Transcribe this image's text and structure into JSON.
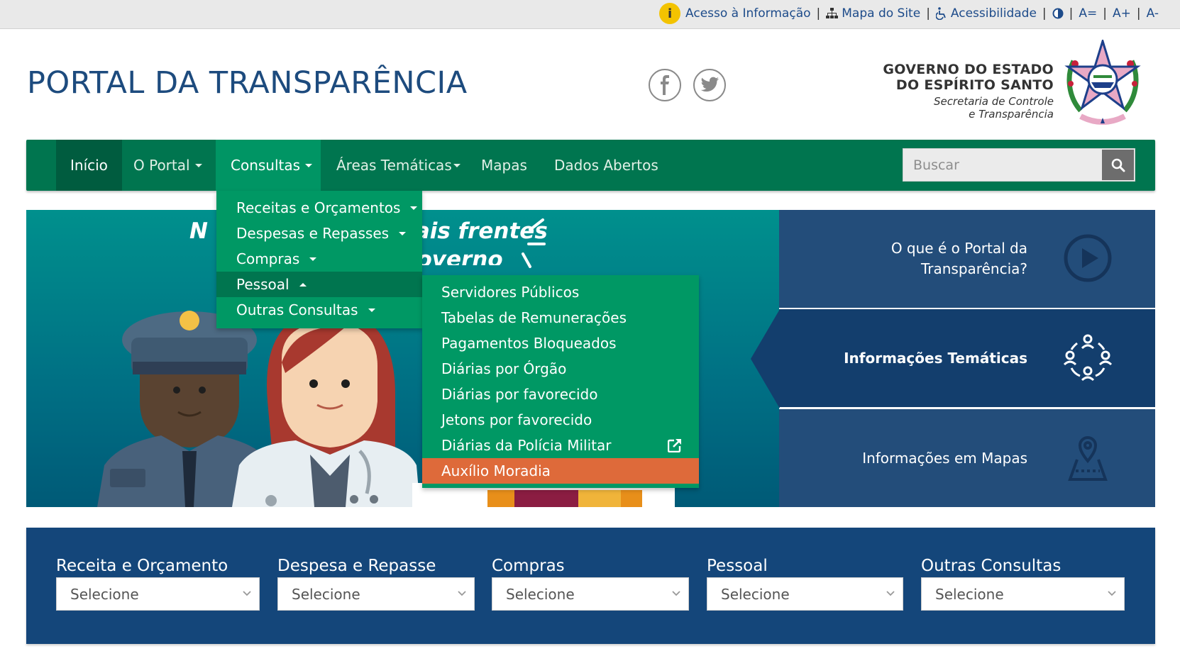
{
  "topbar": {
    "access_info": "Acesso à Informação",
    "site_map": "Mapa do Site",
    "accessibility": "Acessibilidade",
    "font_reset": "A=",
    "font_increase": "A+",
    "font_decrease": "A-",
    "separator": "|"
  },
  "header": {
    "title": "PORTAL DA TRANSPARÊNCIA",
    "gov_line1": "GOVERNO DO ESTADO",
    "gov_line2": "DO ESPÍRITO SANTO",
    "gov_line3": "Secretaria de Controle",
    "gov_line4": "e Transparência"
  },
  "nav": {
    "items": [
      {
        "label": "Início"
      },
      {
        "label": "O Portal"
      },
      {
        "label": "Consultas"
      },
      {
        "label": "Áreas Temáticas"
      },
      {
        "label": "Mapas"
      },
      {
        "label": "Dados Abertos"
      }
    ],
    "search_placeholder": "Buscar"
  },
  "consultas_menu": {
    "items": [
      {
        "label": "Receitas e Orçamentos"
      },
      {
        "label": "Despesas e Repasses"
      },
      {
        "label": "Compras"
      },
      {
        "label": "Pessoal"
      },
      {
        "label": "Outras Consultas"
      }
    ]
  },
  "pessoal_menu": {
    "items": [
      {
        "label": "Servidores Públicos"
      },
      {
        "label": "Tabelas de Remunerações"
      },
      {
        "label": "Pagamentos Bloqueados"
      },
      {
        "label": "Diárias por Órgão"
      },
      {
        "label": "Diárias por favorecido"
      },
      {
        "label": "Jetons por favorecido"
      },
      {
        "label": "Diárias da Polícia Militar"
      },
      {
        "label": "Auxílio Moradia"
      }
    ]
  },
  "hero": {
    "text_left": "N",
    "text_right": "ipais frentes",
    "text_line2": "Governo"
  },
  "panels": {
    "p1_line1": "O que é o Portal da",
    "p1_line2": "Transparência?",
    "p2": "Informações Temáticas",
    "p3": "Informações em Mapas"
  },
  "filters": {
    "items": [
      {
        "label": "Receita e Orçamento",
        "value": "Selecione"
      },
      {
        "label": "Despesa e Repasse",
        "value": "Selecione"
      },
      {
        "label": "Compras",
        "value": "Selecione"
      },
      {
        "label": "Pessoal",
        "value": "Selecione"
      },
      {
        "label": "Outras Consultas",
        "value": "Selecione"
      }
    ]
  },
  "colors": {
    "nav_green": "#00754f",
    "menu_green": "#009864",
    "highlight_orange": "#de6a3a",
    "panel_blue": "#234d7a",
    "filter_blue": "#14467a"
  }
}
